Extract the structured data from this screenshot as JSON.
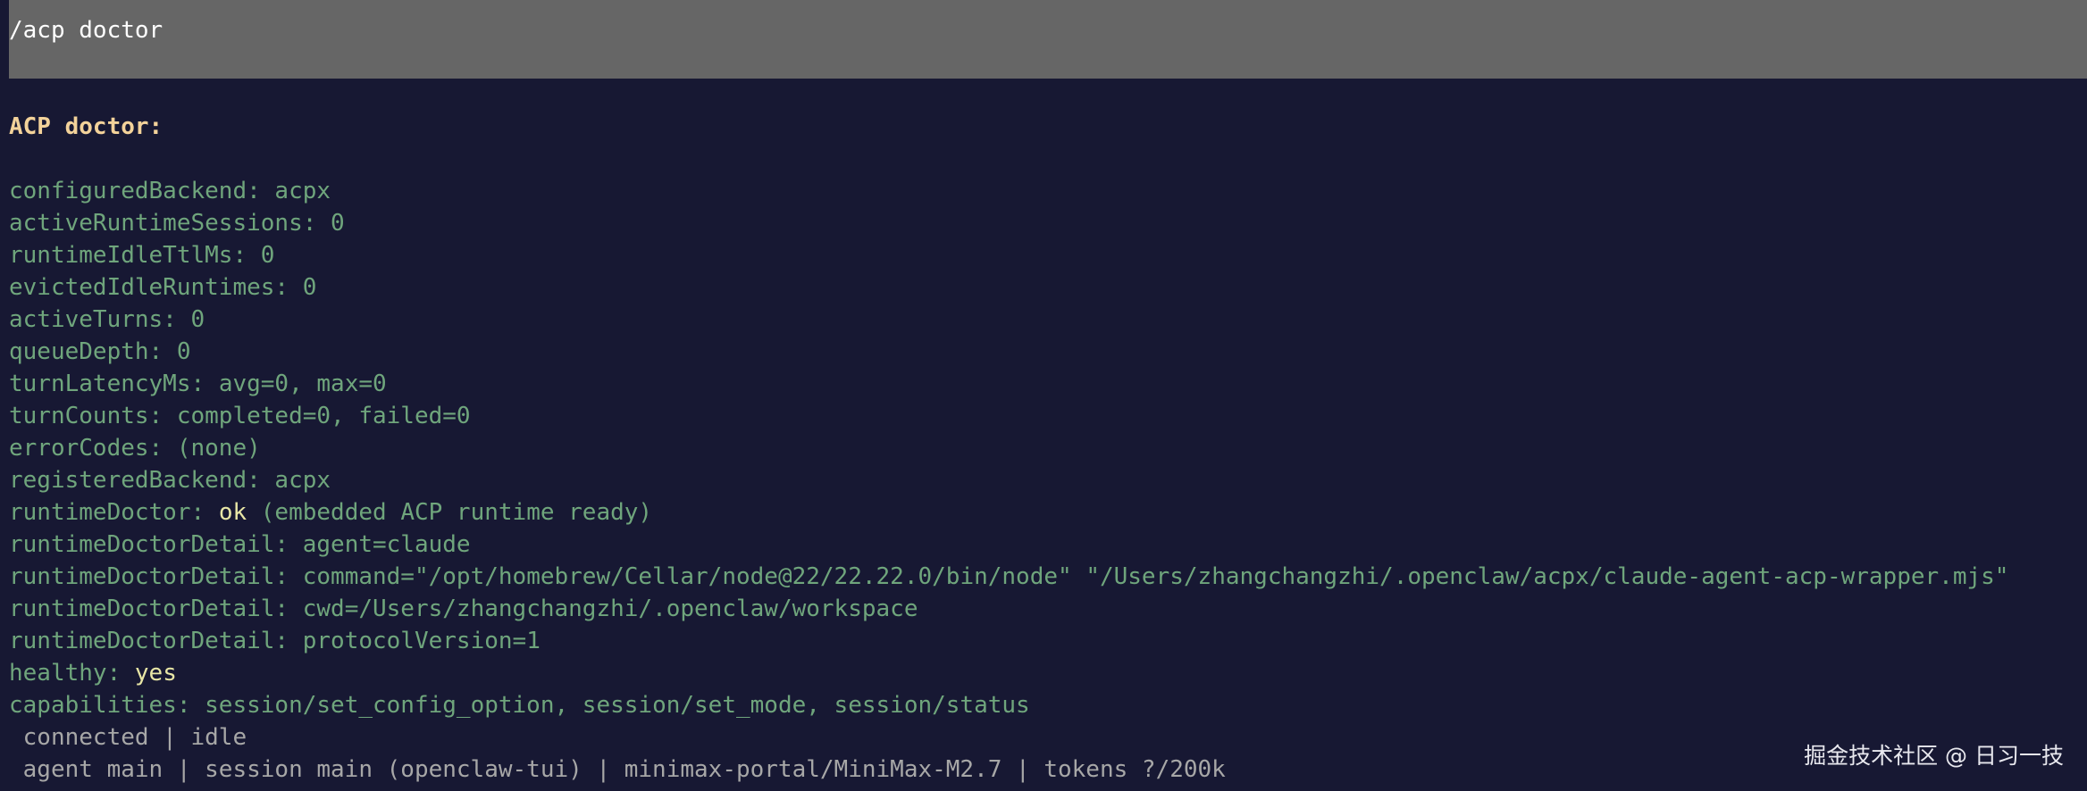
{
  "input": {
    "command": "/acp doctor"
  },
  "output": {
    "heading": "ACP doctor:",
    "fields": [
      {
        "key": "configuredBackend:",
        "value": "acpx"
      },
      {
        "key": "activeRuntimeSessions:",
        "value": "0"
      },
      {
        "key": "runtimeIdleTtlMs:",
        "value": "0"
      },
      {
        "key": "evictedIdleRuntimes:",
        "value": "0"
      },
      {
        "key": "activeTurns:",
        "value": "0"
      },
      {
        "key": "queueDepth:",
        "value": "0"
      },
      {
        "key": "turnLatencyMs:",
        "value": "avg=0, max=0"
      },
      {
        "key": "turnCounts:",
        "value": "completed=0, failed=0"
      },
      {
        "key": "errorCodes:",
        "value": "(none)"
      },
      {
        "key": "registeredBackend:",
        "value": "acpx"
      },
      {
        "key": "runtimeDoctor:",
        "status": "ok",
        "value": "(embedded ACP runtime ready)"
      },
      {
        "key": "runtimeDoctorDetail:",
        "value": "agent=claude"
      },
      {
        "key": "runtimeDoctorDetail:",
        "value": "command=\"/opt/homebrew/Cellar/node@22/22.22.0/bin/node\" \"/Users/zhangchangzhi/.openclaw/acpx/claude-agent-acp-wrapper.mjs\""
      },
      {
        "key": "runtimeDoctorDetail:",
        "value": "cwd=/Users/zhangchangzhi/.openclaw/workspace"
      },
      {
        "key": "runtimeDoctorDetail:",
        "value": "protocolVersion=1"
      },
      {
        "key": "healthy:",
        "status": "yes"
      },
      {
        "key": "capabilities:",
        "value": "session/set_config_option, session/set_mode, session/status"
      }
    ]
  },
  "status_bar": {
    "connection": " connected | idle",
    "session": " agent main | session main (openclaw-tui) | minimax-portal/MiniMax-M2.7 | tokens ?/200k"
  },
  "watermark": "掘金技术社区 @ 日习一技"
}
